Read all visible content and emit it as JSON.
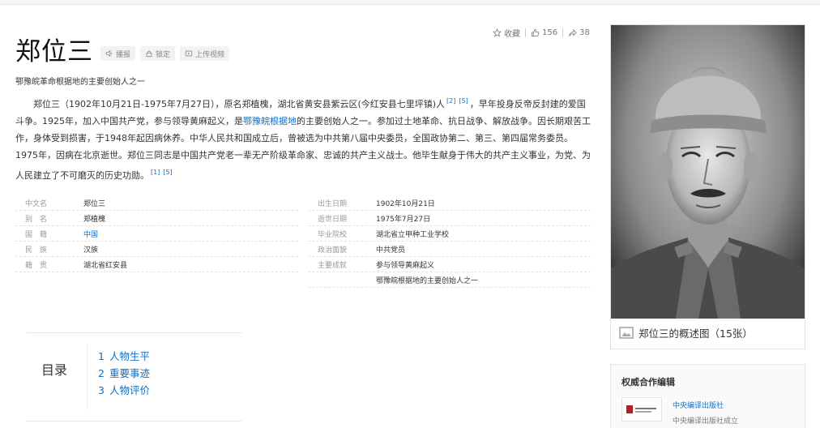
{
  "actions": {
    "favorite_label": "收藏",
    "like_count": "156",
    "share_count": "38"
  },
  "entry": {
    "title": "郑位三",
    "tools": [
      "播报",
      "锁定",
      "上传视频"
    ],
    "subtitle": "鄂豫皖革命根据地的主要创始人之一",
    "summary": {
      "p1": "郑位三（1902年10月21日-1975年7月27日），原名郑植槐，湖北省黄安县紫云区(今红安县七里坪镇)人",
      "ref1": "[2]",
      "ref2": "[5]",
      "p2": "，早年投身反帝反封建的爱国斗争。1925年，加入中国共产党，参与领导黄麻起义，是",
      "link": "鄂豫皖根据地",
      "p3": "的主要创始人之一。参加过土地革命、抗日战争、解放战争。因长期艰苦工作，身体受到损害，于1948年起因病休养。中华人民共和国成立后，曾被选为中共第八届中央委员，全国政协第二、第三、第四届常务委员。1975年，因病在北京逝世。郑位三同志是中国共产党老一辈无产阶级革命家、忠诚的共产主义战士。他毕生献身于伟大的共产主义事业，为党、为人民建立了不可磨灭的历史功勋。",
      "ref3": "[1]",
      "ref4": "[5]"
    }
  },
  "infobox": {
    "left": [
      {
        "k": "中文名",
        "v": "郑位三"
      },
      {
        "k": "别　名",
        "v": "郑植槐"
      },
      {
        "k": "国　籍",
        "v": "中国"
      },
      {
        "k": "民　族",
        "v": "汉族"
      },
      {
        "k": "籍　贯",
        "v": "湖北省红安县"
      }
    ],
    "right": [
      {
        "k": "出生日期",
        "v": "1902年10月21日"
      },
      {
        "k": "逝世日期",
        "v": "1975年7月27日"
      },
      {
        "k": "毕业院校",
        "v": "湖北省立甲种工业学校"
      },
      {
        "k": "政治面貌",
        "v": "中共党员"
      },
      {
        "k": "主要成就",
        "v": "参与领导黄麻起义"
      },
      {
        "k": "",
        "v": "鄂豫皖根据地的主要创始人之一"
      }
    ]
  },
  "toc": {
    "title": "目录",
    "items": [
      {
        "num": "1",
        "label": "人物生平"
      },
      {
        "num": "2",
        "label": "重要事迹"
      },
      {
        "num": "3",
        "label": "人物评价"
      }
    ]
  },
  "photo": {
    "caption": "郑位三的概述图（15张）"
  },
  "authority": {
    "title": "权威合作编辑",
    "name": "中央编译出版社",
    "desc": "中央编译出版社成立"
  }
}
